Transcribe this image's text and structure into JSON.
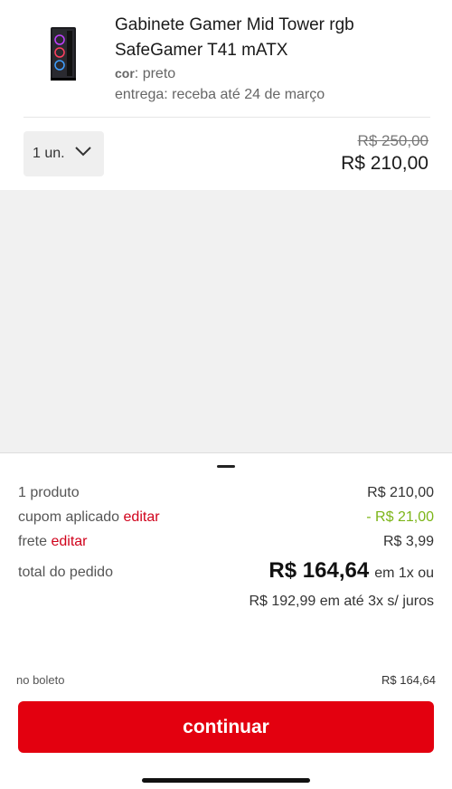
{
  "product": {
    "title": "Gabinete Gamer Mid Tower rgb SafeGamer T41 mATX",
    "color_label": "cor",
    "color_value": ": preto",
    "delivery": "entrega: receba até 24 de março",
    "image_icon": "pc-case-icon",
    "quantity": "1 un.",
    "price_old": "R$ 250,00",
    "price_new": "R$ 210,00"
  },
  "summary": {
    "products_label": "1 produto",
    "products_value": "R$ 210,00",
    "coupon_label": "cupom aplicado",
    "coupon_link": "editar",
    "coupon_value": "- R$ 21,00",
    "shipping_label": "frete",
    "shipping_link": "editar",
    "shipping_value": "R$ 3,99",
    "total_label": "total do pedido",
    "total_value": "R$ 164,64",
    "total_suffix": "em 1x ou",
    "installments": "R$ 192,99 em até 3x s/ juros",
    "boleto_label": "no boleto",
    "boleto_value": "R$ 164,64"
  },
  "cta": {
    "label": "continuar"
  },
  "colors": {
    "accent_red": "#e3000f",
    "link_red": "#d0021b",
    "discount_green": "#7cb518"
  }
}
